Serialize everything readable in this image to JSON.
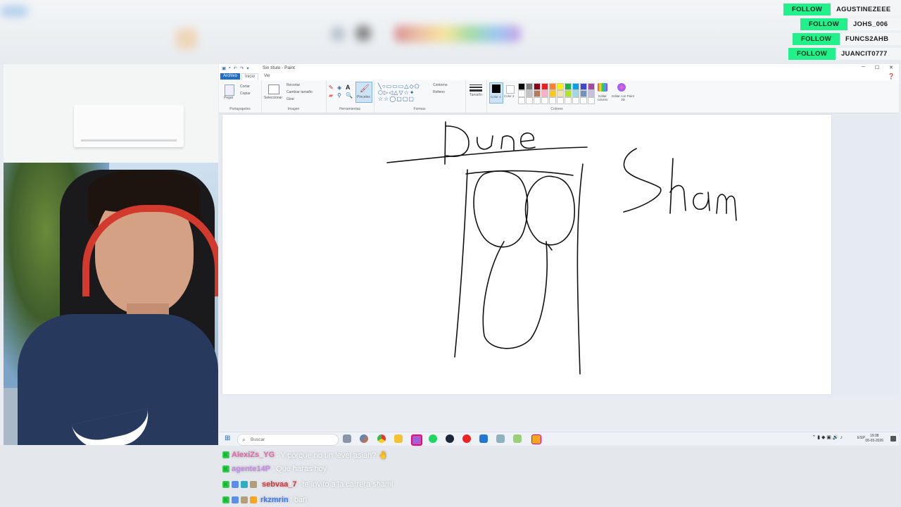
{
  "follows": [
    {
      "button": "FOLLOW",
      "name": "AGUSTINEZEEE"
    },
    {
      "button": "FOLLOW",
      "name": "JOHS_006"
    },
    {
      "button": "FOLLOW",
      "name": "FUNCS2AHB"
    },
    {
      "button": "FOLLOW",
      "name": "JUANCIT0777"
    }
  ],
  "paint": {
    "title": "Sin título - Paint",
    "tabs": [
      "Archivo",
      "Inicio",
      "Ver"
    ],
    "groups": {
      "clipboard": {
        "label": "Portapapeles",
        "paste": "Pegar",
        "cut": "Cortar",
        "copy": "Copiar"
      },
      "image": {
        "label": "Imagen",
        "select": "Seleccionar",
        "crop": "Recortar",
        "resize": "Cambiar tamaño",
        "rotate": "Girar"
      },
      "tools": {
        "label": "Herramientas",
        "brushes": "Pinceles"
      },
      "shapes": {
        "label": "Formas",
        "outline": "Contorno",
        "fill": "Relleno"
      },
      "size": {
        "label": "Tamaño"
      },
      "colors": {
        "label": "Colores",
        "color1": "Color 1",
        "color2": "Color 2",
        "edit": "Editar colores",
        "paint3d": "Editar con Paint 3D"
      }
    },
    "accent": "#1f6dc4",
    "canvas_text": {
      "left_word": "Dune",
      "right_word": "Sham"
    }
  },
  "taskbar": {
    "search_placeholder": "Buscar",
    "lang": "ESP",
    "time": "19:38",
    "date": "06-03-2026"
  },
  "chat": [
    {
      "user": "AlexiZs_YG",
      "color": "#e56aa8",
      "message": "Y porque no un level asian? 🤚"
    },
    {
      "user": "agente14P",
      "color": "#c98be8",
      "message": "Que haras hoy"
    },
    {
      "user": "sebvaa_7",
      "color": "#e0333b",
      "message": "te invito a la carrera shami"
    },
    {
      "user": "rkzmrin",
      "color": "#3a7bff",
      "message": "ban"
    }
  ]
}
